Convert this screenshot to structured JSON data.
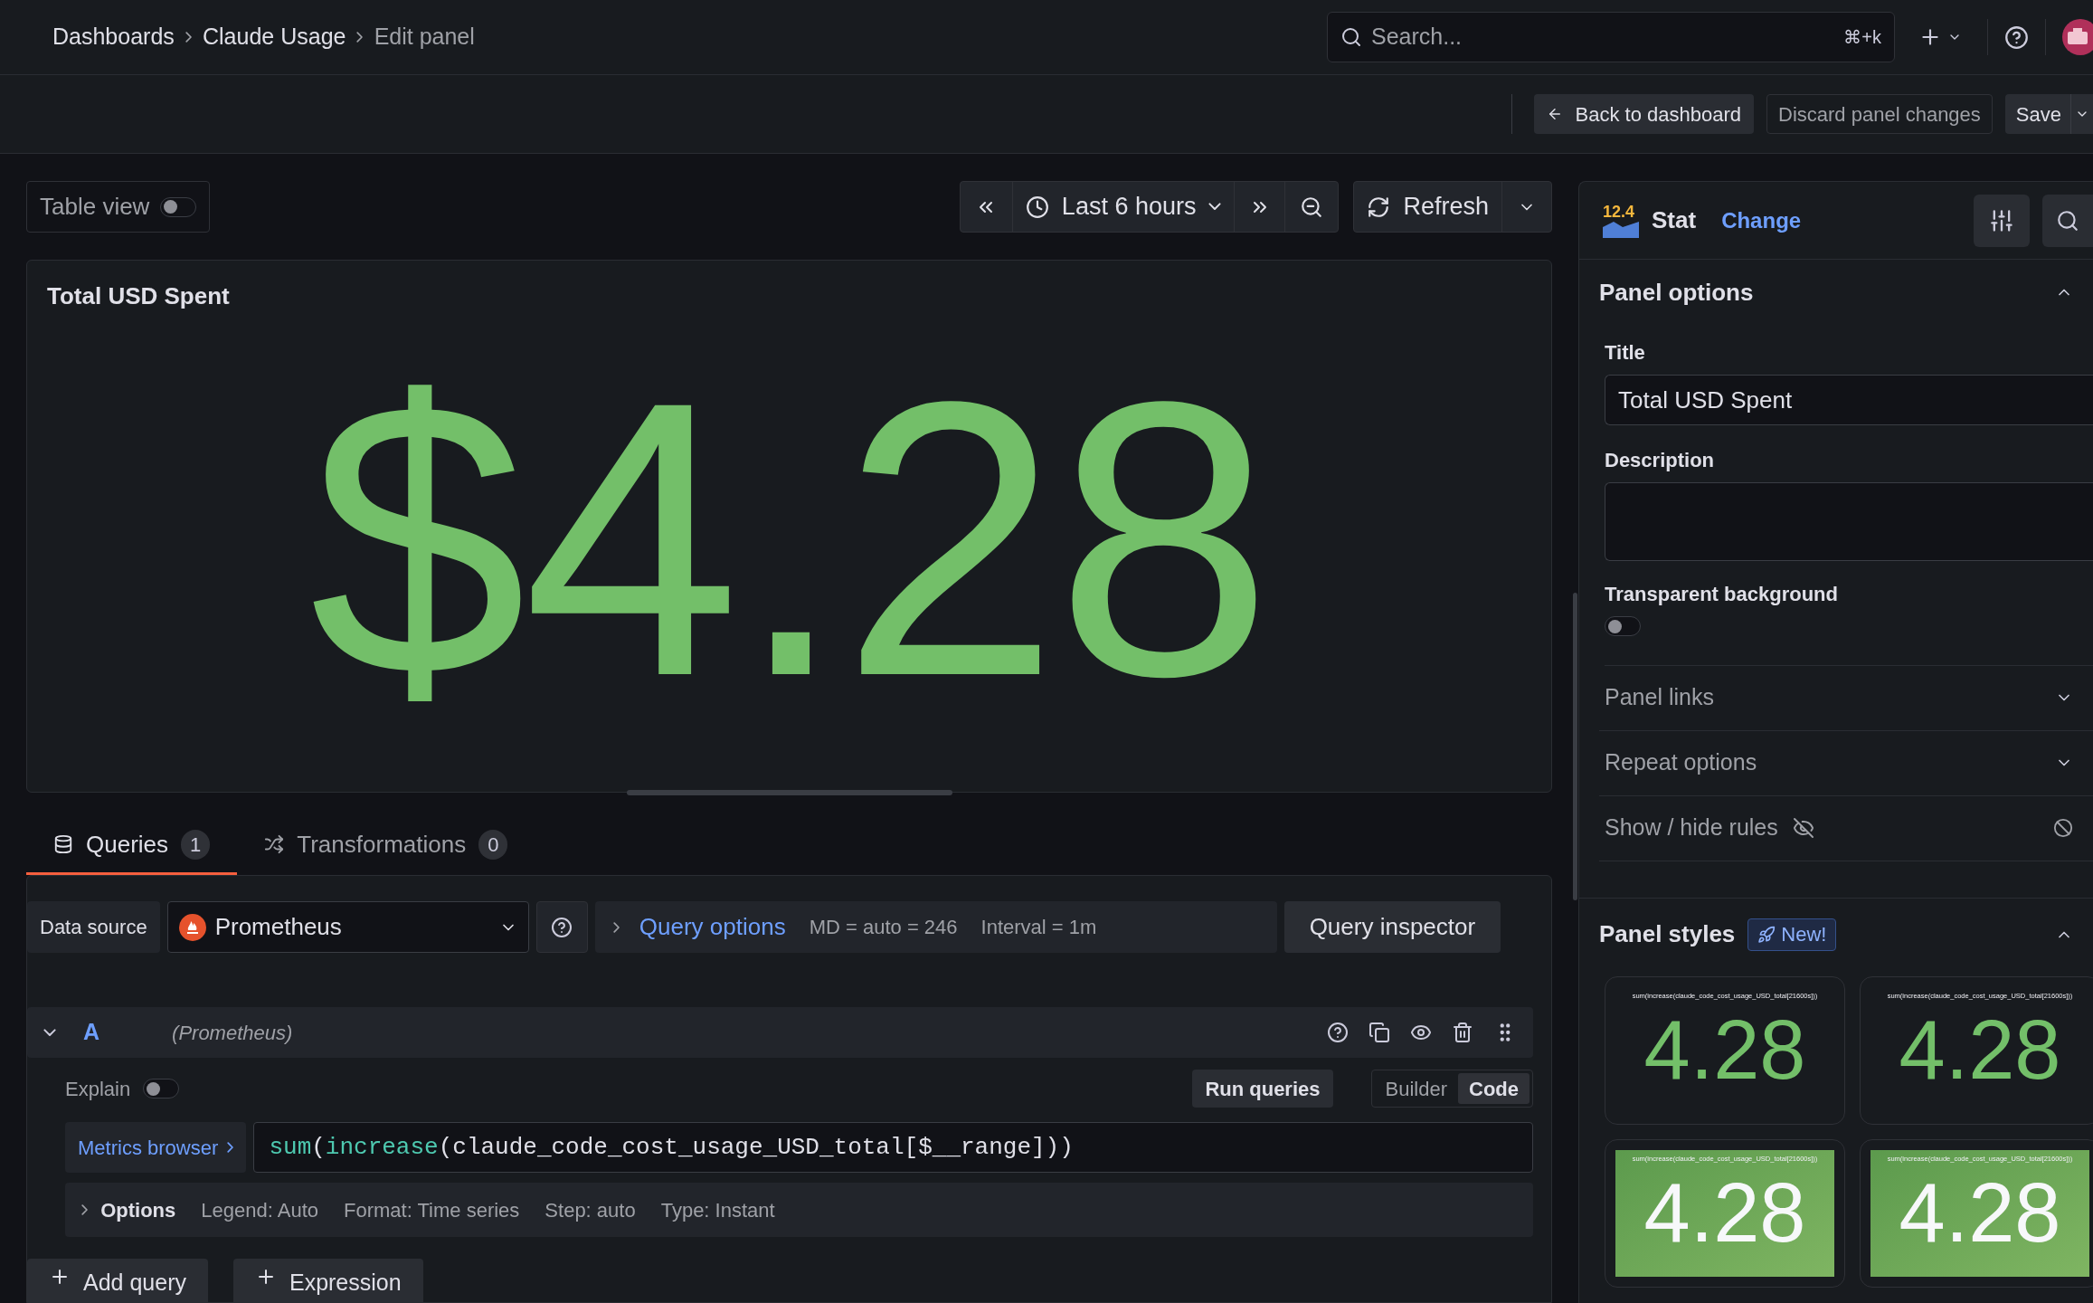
{
  "breadcrumbs": [
    {
      "label": "Dashboards",
      "current": false
    },
    {
      "label": "Claude Usage",
      "current": false
    },
    {
      "label": "Edit panel",
      "current": true
    }
  ],
  "search": {
    "placeholder": "Search...",
    "shortcut": "⌘+k"
  },
  "toolbar": [
    {
      "label": "Back to dashboard",
      "kind": "back"
    },
    {
      "label": "Discard panel changes",
      "kind": "secondary"
    },
    {
      "label": "Save",
      "kind": "save"
    }
  ],
  "table_view": {
    "label": "Table view",
    "on": false
  },
  "time_range": {
    "label": "Last 6 hours"
  },
  "refresh": {
    "label": "Refresh"
  },
  "panel": {
    "title": "Total USD Spent",
    "value": "$4.28",
    "color": "#73bf69"
  },
  "tabs": [
    {
      "label": "Queries",
      "count": "1",
      "selected": true,
      "kind": "queries"
    },
    {
      "label": "Transformations",
      "count": "0",
      "selected": false,
      "kind": "transformations"
    }
  ],
  "query_bar": {
    "data_source_label": "Data source",
    "data_source": "Prometheus",
    "query_options": "Query options",
    "md": "MD = auto = 246",
    "interval": "Interval = 1m",
    "inspector": "Query inspector"
  },
  "query": {
    "ref": "A",
    "source": "(Prometheus)",
    "expanded": true,
    "explain": {
      "label": "Explain",
      "on": false
    },
    "run": "Run queries",
    "modes": [
      {
        "label": "Builder",
        "selected": false
      },
      {
        "label": "Code",
        "selected": true
      }
    ],
    "metrics_browser": "Metrics browser",
    "expr": [
      {
        "text": "sum",
        "kind": "function"
      },
      {
        "text": "(",
        "kind": "plain"
      },
      {
        "text": "increase",
        "kind": "function"
      },
      {
        "text": "(claude_code_cost_usage_USD_total[$__range]))",
        "kind": "plain"
      }
    ],
    "options_label": "Options",
    "options": [
      "Legend: Auto",
      "Format: Time series",
      "Step: auto",
      "Type: Instant"
    ]
  },
  "add_buttons": [
    "Add query",
    "Expression"
  ],
  "viz": {
    "version": "12.4",
    "name": "Stat",
    "change": "Change"
  },
  "panel_options": {
    "heading": "Panel options",
    "expanded": true,
    "title_label": "Title",
    "title_value": "Total USD Spent",
    "description_label": "Description",
    "transparent_label": "Transparent background",
    "transparent_on": false
  },
  "collapsed_sections": [
    {
      "label": "Panel links",
      "kind": "chevron"
    },
    {
      "label": "Repeat options",
      "kind": "chevron"
    },
    {
      "label": "Show / hide rules",
      "kind": "rules"
    }
  ],
  "panel_styles": {
    "heading": "Panel styles",
    "badge": "New!",
    "expanded": true,
    "cards": [
      {
        "caption": "sum(increase(claude_code_cost_usage_USD_total[21600s]))",
        "value": "4.28",
        "kind": "plain"
      },
      {
        "caption": "sum(increase(claude_code_cost_usage_USD_total[21600s]))",
        "value": "4.28",
        "kind": "plain"
      },
      {
        "caption": "sum(increase(claude_code_cost_usage_USD_total[21600s]))",
        "value": "4.28",
        "kind": "filled"
      },
      {
        "caption": "sum(increase(claude_code_cost_usage_USD_total[21600s]))",
        "value": "4.28",
        "kind": "filled"
      }
    ]
  }
}
